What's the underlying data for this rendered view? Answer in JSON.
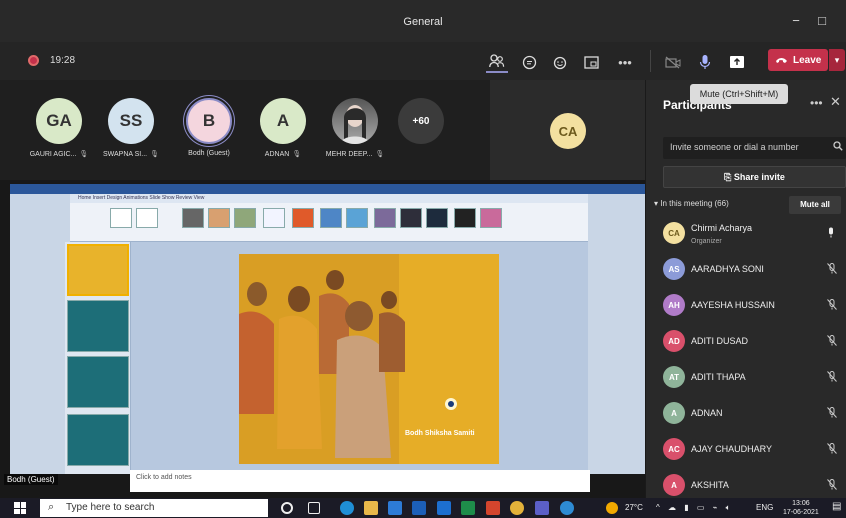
{
  "window": {
    "title": "General",
    "minimize": "−",
    "maximize": "□"
  },
  "toolbar": {
    "timer": "19:28",
    "leave_label": "Leave",
    "mute_tooltip": "Mute (Ctrl+Shift+M)"
  },
  "strip": {
    "participants": [
      {
        "initials": "GA",
        "name": "GAURI AGIC...",
        "color": "#d9e9c8"
      },
      {
        "initials": "SS",
        "name": "SWAPNA SI...",
        "color": "#d3e3ef"
      },
      {
        "initials": "B",
        "name": "Bodh (Guest)",
        "color": "#f4d6de"
      },
      {
        "initials": "A",
        "name": "ADNAN",
        "color": "#d9e9c8"
      },
      {
        "initials": "",
        "name": "MEHR DEEP...",
        "color": "#888888"
      }
    ],
    "overflow": "+60",
    "spotlight_initials": "CA"
  },
  "share": {
    "presenter": "Bodh (Guest)",
    "notes_placeholder": "Click to add notes",
    "slide_logo_text": "Bodh Shiksha Samiti",
    "ribbon_tabs": "Home   Insert   Design   Animations   Slide Show   Review   View"
  },
  "panel": {
    "title": "Participants",
    "invite_placeholder": "Invite someone or dial a number",
    "share_invite": "Share invite",
    "in_meeting": "In this meeting (66)",
    "mute_all": "Mute all",
    "people": [
      {
        "initials": "CA",
        "name": "Chirmi Acharya",
        "role": "Organizer",
        "color": "#f3e0a0",
        "text_color": "#6d5a1d",
        "mic": "on"
      },
      {
        "initials": "AS",
        "name": "AARADHYA SONI",
        "role": "",
        "color": "#8c9bd8",
        "text_color": "#ffffff",
        "mic": "off"
      },
      {
        "initials": "AH",
        "name": "AAYESHA HUSSAIN",
        "role": "",
        "color": "#b07bc8",
        "text_color": "#ffffff",
        "mic": "off"
      },
      {
        "initials": "AD",
        "name": "ADITI DUSAD",
        "role": "",
        "color": "#d9506b",
        "text_color": "#ffffff",
        "mic": "off"
      },
      {
        "initials": "AT",
        "name": "ADITI THAPA",
        "role": "",
        "color": "#8fb49a",
        "text_color": "#ffffff",
        "mic": "off"
      },
      {
        "initials": "A",
        "name": "ADNAN",
        "role": "",
        "color": "#8fb49a",
        "text_color": "#ffffff",
        "mic": "off"
      },
      {
        "initials": "AC",
        "name": "AJAY CHAUDHARY",
        "role": "",
        "color": "#d9506b",
        "text_color": "#ffffff",
        "mic": "off"
      },
      {
        "initials": "A",
        "name": "AKSHITA",
        "role": "",
        "color": "#d9506b",
        "text_color": "#ffffff",
        "mic": "off"
      }
    ]
  },
  "taskbar": {
    "search_placeholder": "Type here to search",
    "temperature": "27°C",
    "language": "ENG",
    "time": "13:06",
    "date": "17-06-2021"
  }
}
